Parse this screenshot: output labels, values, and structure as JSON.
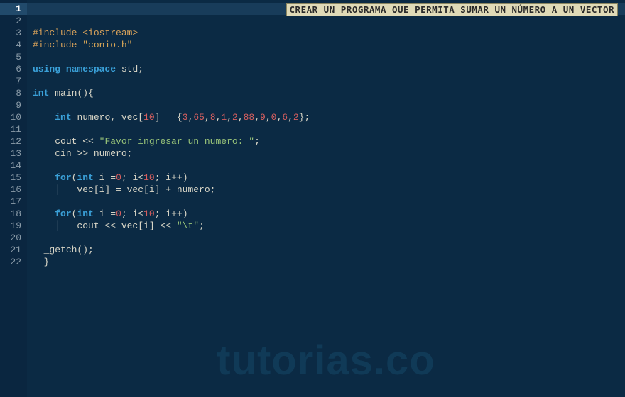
{
  "banner": "CREAR UN PROGRAMA QUE PERMITA SUMAR UN NÚMERO A UN VECTOR",
  "watermark": "tutorias.co",
  "current_line": 1,
  "gutter": [
    "1",
    "2",
    "3",
    "4",
    "5",
    "6",
    "7",
    "8",
    "9",
    "10",
    "11",
    "12",
    "13",
    "14",
    "15",
    "16",
    "17",
    "18",
    "19",
    "20",
    "21",
    "22"
  ],
  "code": {
    "l3": {
      "inc": "#include ",
      "lt": "<iostream>"
    },
    "l4": {
      "inc": "#include ",
      "str": "\"conio.h\""
    },
    "l6": {
      "kw1": "using",
      "sp1": " ",
      "kw2": "namespace",
      "sp2": " ",
      "id": "std",
      "semi": ";"
    },
    "l8": {
      "kw1": "int",
      "sp": " ",
      "id": "main",
      "paren": "(){"
    },
    "l10": {
      "indent": "    ",
      "kw": "int",
      "sp": " ",
      "id1": "numero, vec[",
      "n1": "10",
      "b1": "] = {",
      "a0": "3",
      "c0": ",",
      "a1": "65",
      "c1": ",",
      "a2": "8",
      "c2": ",",
      "a3": "1",
      "c3": ",",
      "a4": "2",
      "c4": ",",
      "a5": "88",
      "c5": ",",
      "a6": "9",
      "c6": ",",
      "a7": "0",
      "c7": ",",
      "a8": "6",
      "c8": ",",
      "a9": "2",
      "end": "};"
    },
    "l12": {
      "indent": "    ",
      "id": "cout << ",
      "str": "\"Favor ingresar un numero: \"",
      "semi": ";"
    },
    "l13": {
      "indent": "    ",
      "id": "cin >> numero;",
      "semi": ""
    },
    "l15": {
      "indent": "    ",
      "kw1": "for",
      "p1": "(",
      "kw2": "int",
      "sp": " ",
      "id": "i =",
      "n1": "0",
      "semi1": "; i<",
      "n2": "10",
      "rest": "; i++)"
    },
    "l16": {
      "indent": "        ",
      "guide": "",
      "id": "vec[i] = vec[i] + numero;"
    },
    "l18": {
      "indent": "    ",
      "kw1": "for",
      "p1": "(",
      "kw2": "int",
      "sp": " ",
      "id": "i =",
      "n1": "0",
      "semi1": "; i<",
      "n2": "10",
      "rest": "; i++)"
    },
    "l19": {
      "indent": "        ",
      "guide": "",
      "id": "cout << vec[i] << ",
      "str": "\"\\t\"",
      "semi": ";"
    },
    "l21": {
      "indent": "  ",
      "id": "_getch();"
    },
    "l22": {
      "indent": "  ",
      "id": "}"
    }
  }
}
